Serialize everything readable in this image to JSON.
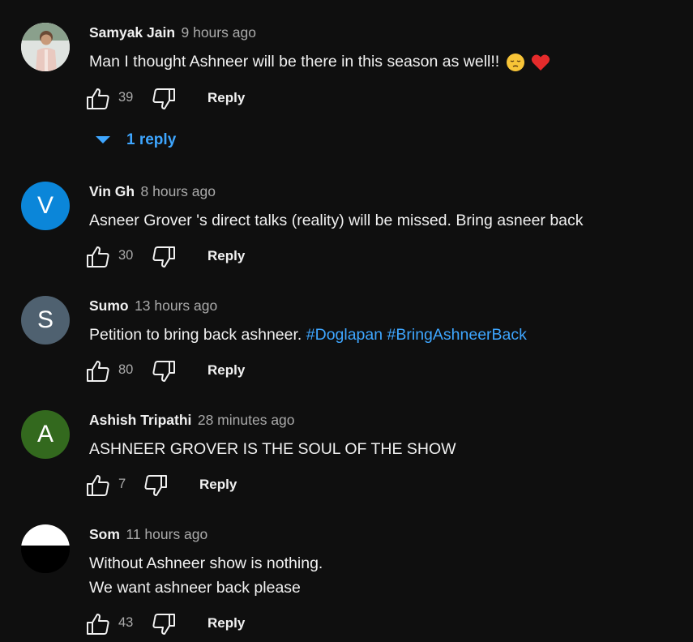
{
  "comments": [
    {
      "author": "Samyak Jain",
      "time": "9 hours ago",
      "text": "Man I thought Ashneer will be there in this season as well!!",
      "likes": "39",
      "reply_label": "Reply",
      "avatar_type": "photo",
      "replies_label": "1 reply"
    },
    {
      "author": "Vin Gh",
      "time": "8 hours ago",
      "text": "Asneer Grover 's direct talks (reality) will be missed. Bring asneer back",
      "likes": "30",
      "reply_label": "Reply",
      "avatar_letter": "V",
      "avatar_color": "#0b86d9"
    },
    {
      "author": "Sumo",
      "time": "13 hours ago",
      "text": "Petition to bring back ashneer.",
      "hashtags": [
        "#Doglapan",
        "#BringAshneerBack"
      ],
      "likes": "80",
      "reply_label": "Reply",
      "avatar_letter": "S",
      "avatar_color": "#4f6170"
    },
    {
      "author": "Ashish Tripathi",
      "time": "28 minutes ago",
      "text": "ASHNEER GROVER IS THE SOUL OF THE SHOW",
      "likes": "7",
      "reply_label": "Reply",
      "avatar_letter": "A",
      "avatar_color": "#33691e"
    },
    {
      "author": "Som",
      "time": "11 hours ago",
      "text_lines": [
        "Without Ashneer show is nothing.",
        "We want ashneer back please"
      ],
      "likes": "43",
      "reply_label": "Reply",
      "avatar_type": "half-white-black"
    }
  ],
  "colors": {
    "background": "#0f0f0f",
    "text": "#f1f1f1",
    "secondary_text": "#aaaaaa",
    "link": "#3ea6ff"
  },
  "icons": [
    "thumbs-up-icon",
    "thumbs-down-icon",
    "chevron-down-icon",
    "pensive-face-emoji",
    "red-heart-emoji"
  ]
}
